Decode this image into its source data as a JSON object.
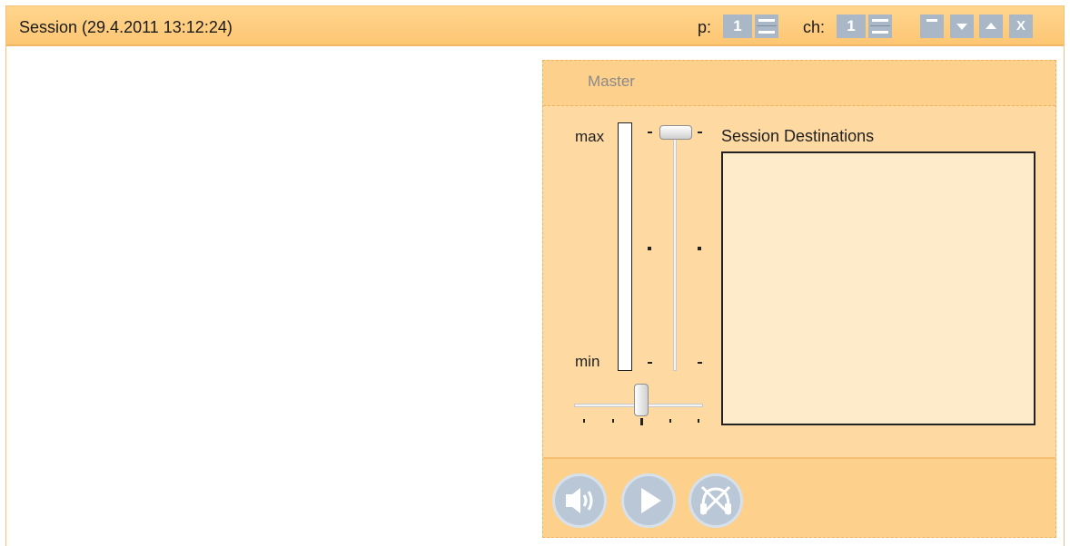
{
  "window": {
    "title": "Session (29.4.2011 13:12:24)",
    "page_label": "p:",
    "page_value": "1",
    "channel_label": "ch:",
    "channel_value": "1",
    "close_label": "X"
  },
  "master": {
    "title": "Master",
    "meter_max_label": "max",
    "meter_min_label": "min",
    "destinations_label": "Session Destinations"
  },
  "footer": {
    "buttons": [
      "speaker-icon",
      "play-icon",
      "headphones-muted-icon"
    ]
  },
  "colors": {
    "title_bar": "#fdc673",
    "panel": "#fdd08c",
    "button": "#a9b7c6"
  }
}
